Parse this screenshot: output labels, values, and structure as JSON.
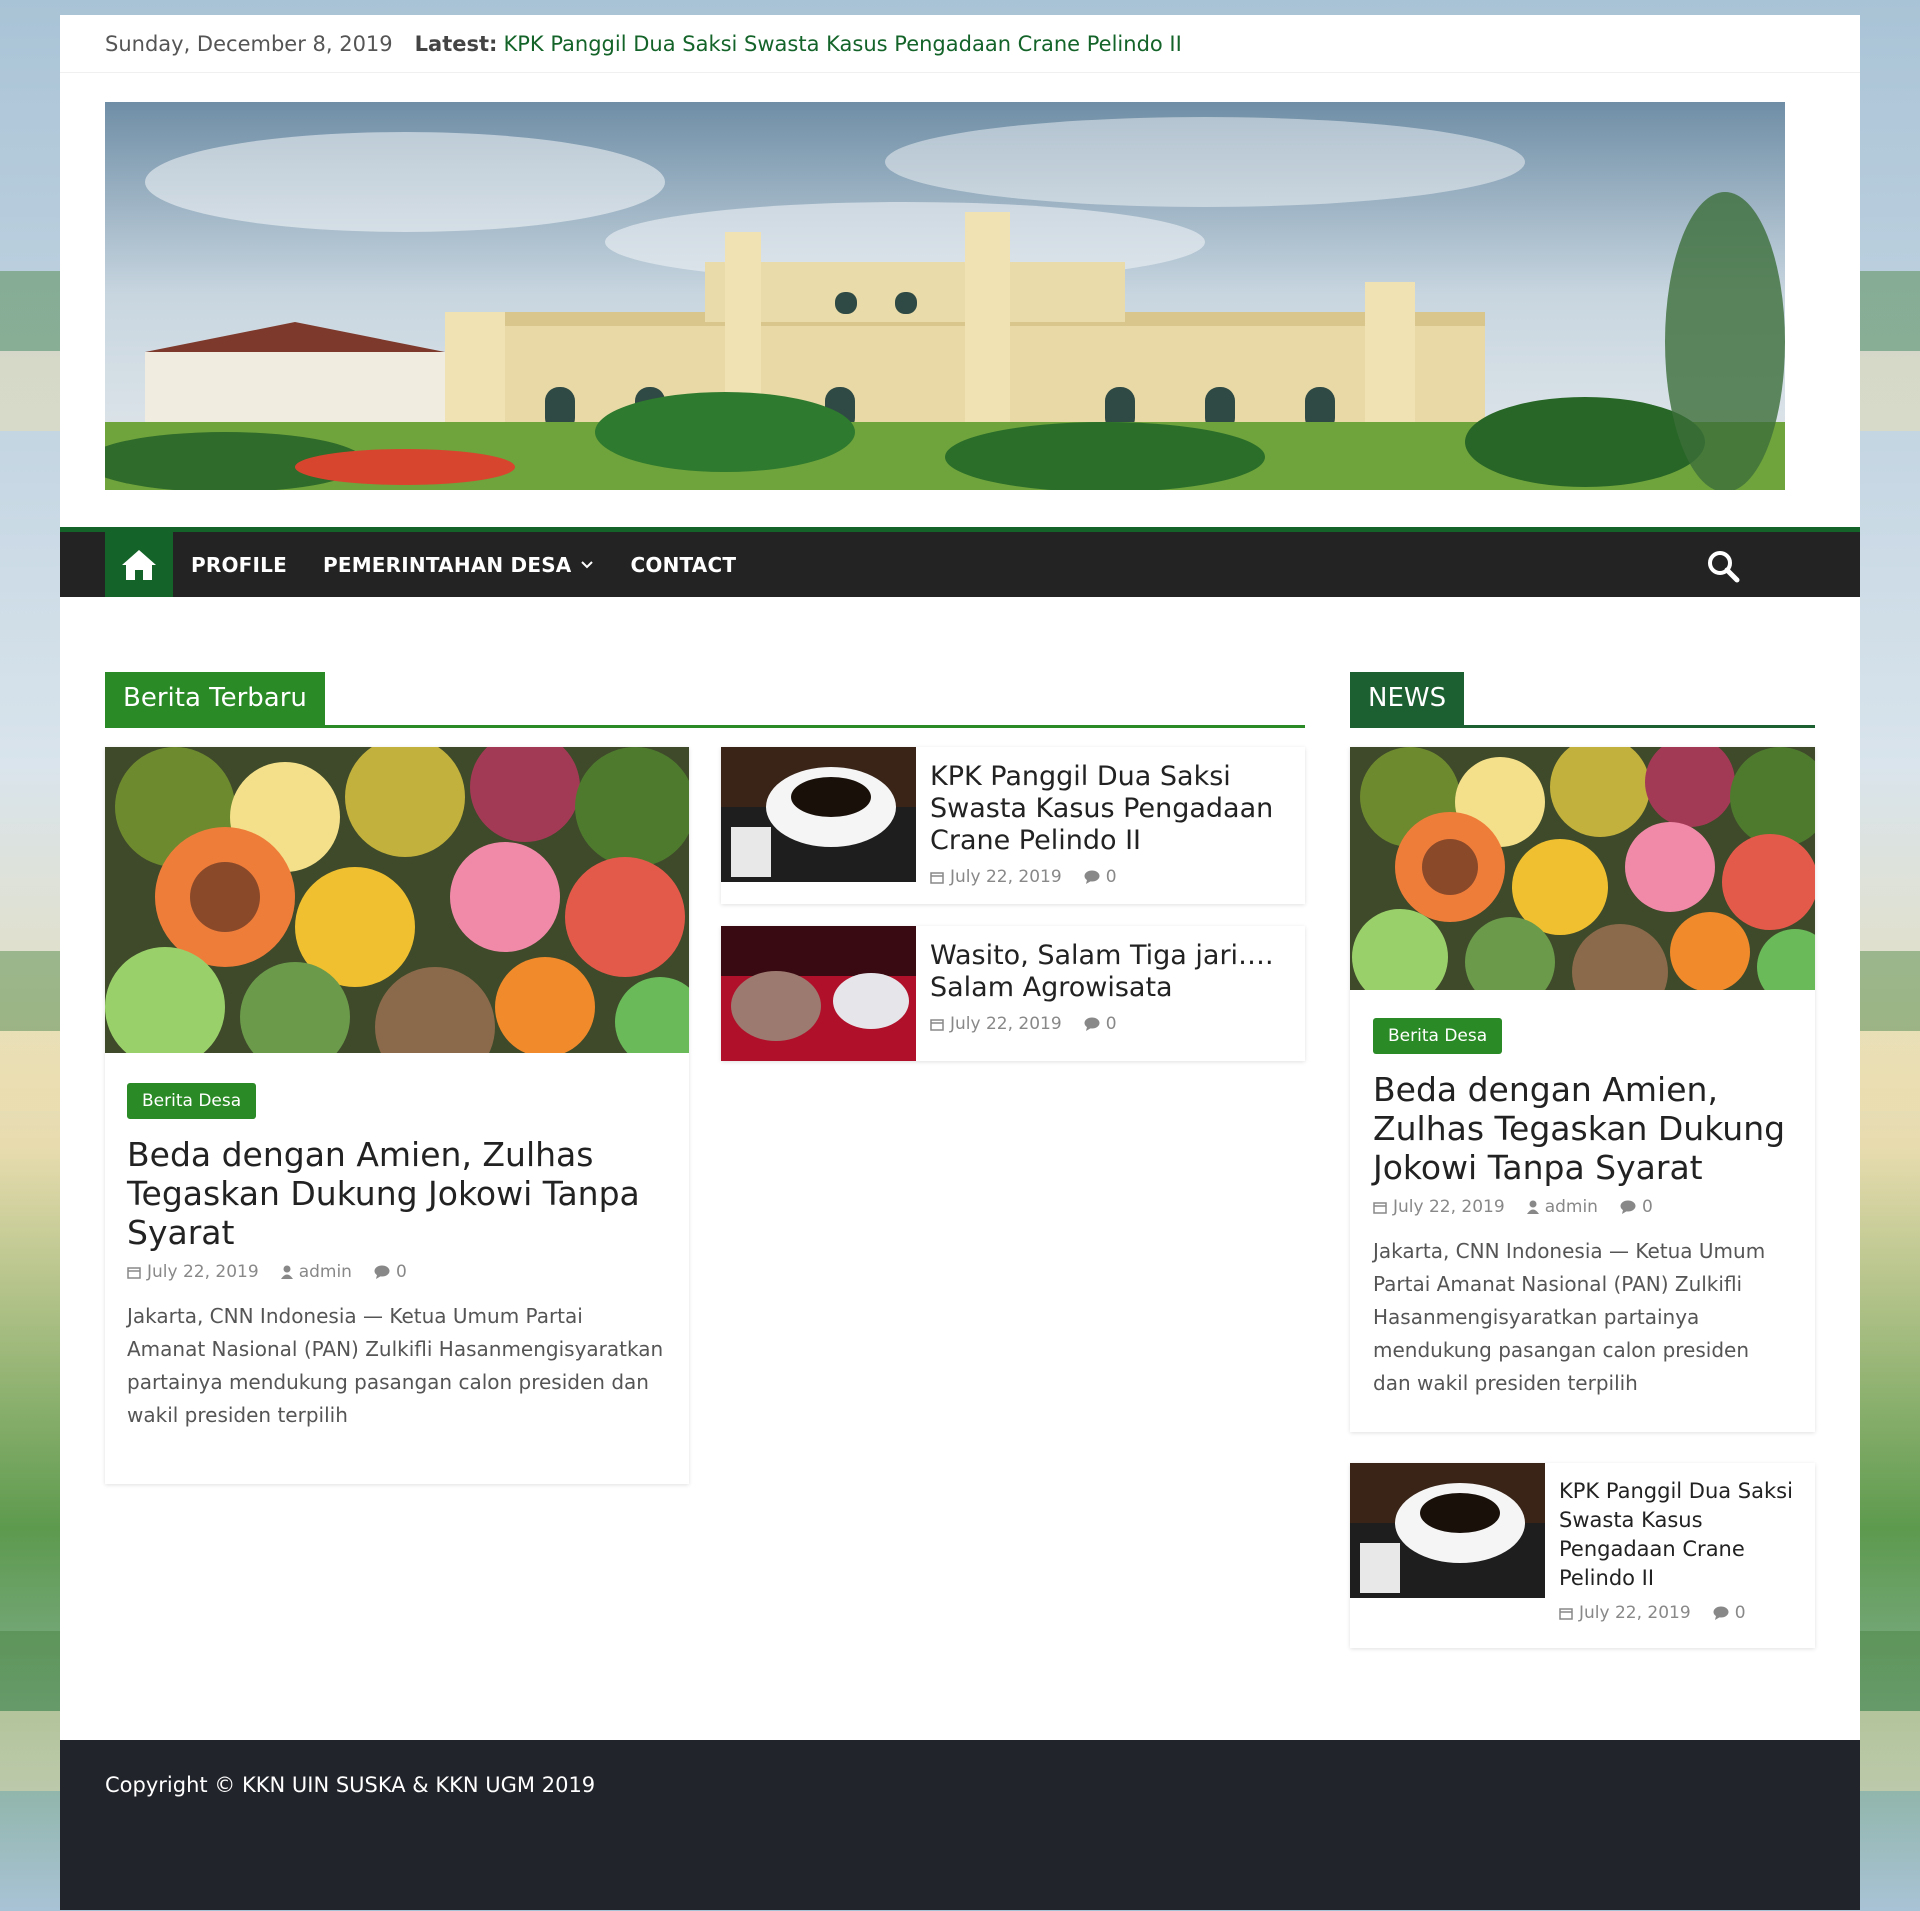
{
  "topbar": {
    "date": "Sunday, December 8, 2019",
    "latest_label": "Latest:",
    "latest_link": "KPK Panggil Dua Saksi Swasta Kasus Pengadaan Crane Pelindo II"
  },
  "nav": {
    "items": [
      "PROFILE",
      "PEMERINTAHAN DESA",
      "CONTACT"
    ],
    "icons": {
      "home": "home-icon",
      "search": "search-icon",
      "dropdown": "chevron-down-icon"
    }
  },
  "colors": {
    "accent": "#2a8a25",
    "brand_dark": "#14642a",
    "nav_bg": "#232323",
    "footer_bg": "#22242b"
  },
  "berita": {
    "heading": "Berita Terbaru",
    "featured": {
      "category": "Berita Desa",
      "title": "Beda dengan Amien, Zulhas Tegaskan Dukung Jokowi Tanpa Syarat",
      "date": "July 22, 2019",
      "author": "admin",
      "comments": "0",
      "excerpt": "Jakarta, CNN Indonesia — Ketua Umum Partai Amanat Nasional (PAN) Zulkifli Hasanmengisyaratkan partainya mendukung pasangan calon presiden dan wakil presiden terpilih"
    },
    "list": [
      {
        "title": "KPK Panggil Dua Saksi Swasta Kasus Pengadaan Crane Pelindo II",
        "date": "July 22, 2019",
        "comments": "0"
      },
      {
        "title": "Wasito, Salam Tiga jari…. Salam Agrowisata",
        "date": "July 22, 2019",
        "comments": "0"
      }
    ]
  },
  "news": {
    "heading": "NEWS",
    "featured": {
      "category": "Berita Desa",
      "title": "Beda dengan Amien, Zulhas Tegaskan Dukung Jokowi Tanpa Syarat",
      "date": "July 22, 2019",
      "author": "admin",
      "comments": "0",
      "excerpt": "Jakarta, CNN Indonesia — Ketua Umum Partai Amanat Nasional (PAN) Zulkifli Hasanmengisyaratkan partainya mendukung pasangan calon presiden dan wakil presiden terpilih"
    },
    "list": [
      {
        "title": "KPK Panggil Dua Saksi Swasta Kasus Pengadaan Crane Pelindo II",
        "date": "July 22, 2019",
        "comments": "0"
      }
    ]
  },
  "footer": {
    "copyright": "Copyright © KKN UIN SUSKA & KKN UGM 2019"
  }
}
